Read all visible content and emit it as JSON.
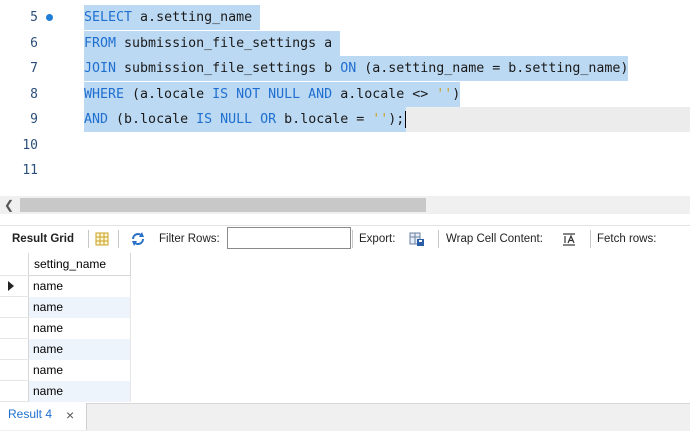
{
  "editor": {
    "lines": [
      {
        "num": "5",
        "marker": true,
        "parts": [
          {
            "t": "SELECT",
            "c": "kw"
          },
          {
            "t": " a.setting_name ",
            "c": ""
          }
        ]
      },
      {
        "num": "6",
        "parts": [
          {
            "t": "FROM",
            "c": "kw"
          },
          {
            "t": " submission_file_settings a ",
            "c": ""
          }
        ]
      },
      {
        "num": "7",
        "parts": [
          {
            "t": "JOIN",
            "c": "kw"
          },
          {
            "t": " submission_file_settings b ",
            "c": ""
          },
          {
            "t": "ON",
            "c": "kw"
          },
          {
            "t": " (a.setting_name = b.setting_name)",
            "c": ""
          }
        ]
      },
      {
        "num": "8",
        "parts": [
          {
            "t": "WHERE",
            "c": "kw"
          },
          {
            "t": " (a.locale ",
            "c": ""
          },
          {
            "t": "IS NOT NULL",
            "c": "kw"
          },
          {
            "t": " ",
            "c": ""
          },
          {
            "t": "AND",
            "c": "kw"
          },
          {
            "t": " a.locale <> ",
            "c": ""
          },
          {
            "t": "''",
            "c": "str"
          },
          {
            "t": ")",
            "c": ""
          }
        ]
      },
      {
        "num": "9",
        "current": true,
        "parts": [
          {
            "t": "AND",
            "c": "kw"
          },
          {
            "t": " (b.locale ",
            "c": ""
          },
          {
            "t": "IS NULL",
            "c": "kw"
          },
          {
            "t": " ",
            "c": ""
          },
          {
            "t": "OR",
            "c": "kw"
          },
          {
            "t": " b.locale = ",
            "c": ""
          },
          {
            "t": "''",
            "c": "str"
          },
          {
            "t": ");",
            "c": ""
          }
        ]
      },
      {
        "num": "10",
        "parts": []
      },
      {
        "num": "11",
        "parts": []
      }
    ],
    "scroll_left_icon": "chevron-left-icon"
  },
  "toolbar": {
    "result_grid": "Result Grid",
    "filter_rows": "Filter Rows:",
    "filter_value": "",
    "export": "Export:",
    "wrap_cell": "Wrap Cell Content:",
    "fetch_rows": "Fetch rows:",
    "icons": {
      "grid": "grid-icon",
      "refresh": "refresh-icon",
      "export": "export-icon",
      "wrap": "wrap-text-icon"
    }
  },
  "grid": {
    "column": "setting_name",
    "rows": [
      "name",
      "name",
      "name",
      "name",
      "name",
      "name"
    ]
  },
  "tabs": {
    "result_tab": "Result 4",
    "close": "×"
  }
}
